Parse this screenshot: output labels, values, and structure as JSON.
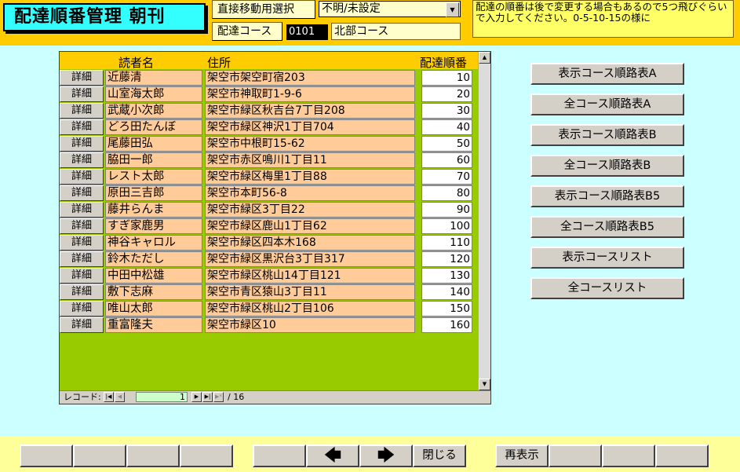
{
  "header": {
    "title": "配達順番管理 朝刊",
    "direct_move_label": "直接移動用選択",
    "direct_select_value": "不明/未設定",
    "course_label": "配達コース",
    "course_code": "0101",
    "course_name": "北部コース",
    "note": "配達の順番は後で変更する場合もあるので5つ飛びぐらいで入力してください。0-5-10-15の様に"
  },
  "table": {
    "columns": {
      "name": "読者名",
      "address": "住所",
      "order": "配達順番"
    },
    "detail_label": "詳細",
    "rows": [
      {
        "name": "近藤清",
        "address": "架空市架空町宿203",
        "order": "10"
      },
      {
        "name": "山室海太郎",
        "address": "架空市神取町1-9-6",
        "order": "20"
      },
      {
        "name": "武蔵小次郎",
        "address": "架空市緑区秋吉台7丁目208",
        "order": "30"
      },
      {
        "name": "どろ田たんぼ",
        "address": "架空市緑区神沢1丁目704",
        "order": "40"
      },
      {
        "name": "尾藤田弘",
        "address": "架空市中根町15-62",
        "order": "50"
      },
      {
        "name": "脇田一郎",
        "address": "架空市赤区鳴川1丁目11",
        "order": "60"
      },
      {
        "name": "レスト太郎",
        "address": "架空市緑区梅里1丁目88",
        "order": "70"
      },
      {
        "name": "原田三吉郎",
        "address": "架空市本町56-8",
        "order": "80"
      },
      {
        "name": "藤井らんま",
        "address": "架空市緑区3丁目22",
        "order": "90"
      },
      {
        "name": "すぎ家鹿男",
        "address": "架空市緑区鹿山1丁目62",
        "order": "100"
      },
      {
        "name": "神谷キャロル",
        "address": "架空市緑区四本木168",
        "order": "110"
      },
      {
        "name": "鈴木ただし",
        "address": "架空市緑区黒沢台3丁目317",
        "order": "120"
      },
      {
        "name": "中田中松雄",
        "address": "架空市緑区桃山14丁目121",
        "order": "130"
      },
      {
        "name": "敷下志麻",
        "address": "架空市青区猿山3丁目11",
        "order": "140"
      },
      {
        "name": "唯山太郎",
        "address": "架空市緑区桃山2丁目106",
        "order": "150"
      },
      {
        "name": "重富隆夫",
        "address": "架空市緑区10",
        "order": "160"
      }
    ]
  },
  "record_nav": {
    "label": "レコード:",
    "current": "1",
    "total": "/ 16"
  },
  "right_buttons": [
    "表示コース順路表A",
    "全コース順路表A",
    "表示コース順路表B",
    "全コース順路表B",
    "表示コース順路表B5",
    "全コース順路表B5",
    "表示コースリスト",
    "全コースリスト"
  ],
  "footer": {
    "close_label": "閉じる",
    "redisplay_label": "再表示"
  }
}
